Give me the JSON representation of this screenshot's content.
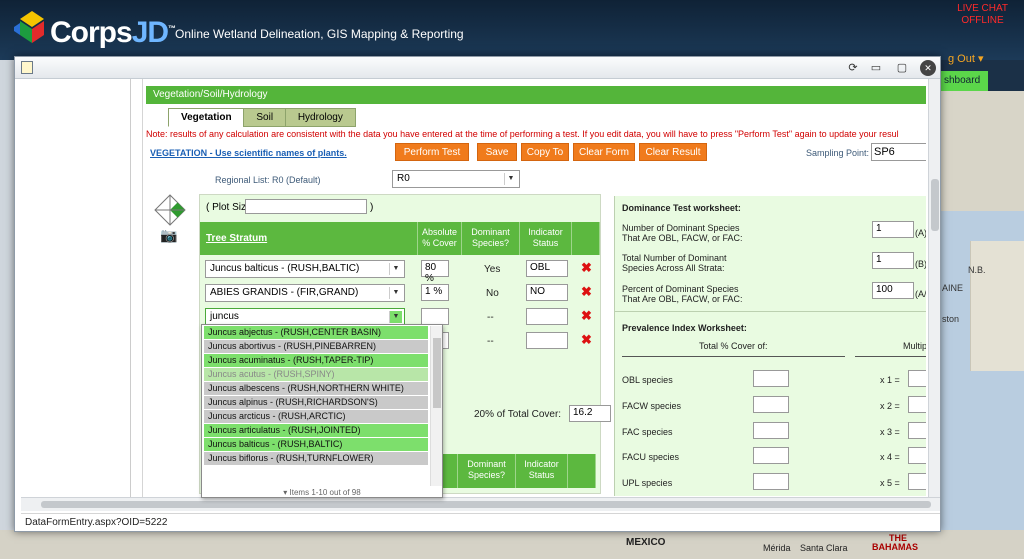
{
  "site": {
    "brand_main": "Corps",
    "brand_accent": "JD",
    "brand_tm": "™",
    "tagline": "Online Wetland Delineation, GIS Mapping & Reporting",
    "live_chat_line1": "LIVE CHAT",
    "live_chat_line2": "OFFLINE",
    "out_link": "g Out ▾",
    "dashboard_tab": "shboard"
  },
  "map": {
    "labels": [
      "N.B.",
      "AINE",
      "ston",
      "MEXICO",
      "Mérida",
      "Santa Clara",
      "THE",
      "BAHAMAS"
    ]
  },
  "window": {
    "controls": [
      "⟳",
      "▭",
      "▢",
      "✕"
    ],
    "status_url": "DataFormEntry.aspx?OID=5222"
  },
  "form": {
    "section_title": "Vegetation/Soil/Hydrology",
    "tabs": [
      "Vegetation",
      "Soil",
      "Hydrology"
    ],
    "active_tab": "Vegetation",
    "note": "Note: results of any calculation are consistent with the data you have entered at the time of performing a test. If you edit data, you will have to press \"Perform Test\" again to update your resul",
    "veg_link": "VEGETATION - Use scientific names of plants.",
    "buttons": {
      "perform_test": "Perform Test",
      "save": "Save",
      "copy_to": "Copy To",
      "clear_form": "Clear Form",
      "clear_result": "Clear Result"
    },
    "sampling_point_label": "Sampling Point:",
    "sampling_point_value": "SP6",
    "regional_list_label": "Regional List:  R0 (Default)",
    "regional_list_value": "R0",
    "plot_size_label": "( Plot Size:",
    "plot_size_close": ")",
    "table_headers": {
      "tree_stratum": "Tree Stratum",
      "absolute_cover": "Absolute % Cover",
      "dominant": "Dominant Species?",
      "indicator": "Indicator Status"
    },
    "rows": [
      {
        "species": "Juncus balticus -    (RUSH,BALTIC)",
        "cover": "80 %",
        "dominant": "Yes",
        "indicator": "OBL"
      },
      {
        "species": "ABIES GRANDIS -    (FIR,GRAND)",
        "cover": "1 %",
        "dominant": "No",
        "indicator": "NO"
      },
      {
        "species": "juncus",
        "cover": "",
        "dominant": "--",
        "indicator": ""
      },
      {
        "species": "",
        "cover": "",
        "dominant": "--",
        "indicator": ""
      }
    ],
    "twenty_pct_label": "20% of Total Cover:",
    "twenty_pct_value": "16.2",
    "table2_headers": {
      "cover_partial": "te\ner",
      "dominant": "Dominant Species?",
      "indicator": "Indicator Status"
    },
    "table2_dominant": "--",
    "autocomplete": {
      "items": [
        "Juncus abjectus - (RUSH,CENTER BASIN)",
        "Juncus abortivus - (RUSH,PINEBARREN)",
        "Juncus acuminatus - (RUSH,TAPER-TIP)",
        "Juncus acutus - (RUSH,SPINY)",
        "Juncus albescens - (RUSH,NORTHERN WHITE)",
        "Juncus alpinus - (RUSH,RICHARDSON'S)",
        "Juncus arcticus - (RUSH,ARCTIC)",
        "Juncus articulatus - (RUSH,JOINTED)",
        "Juncus balticus - (RUSH,BALTIC)",
        "Juncus biflorus - (RUSH,TURNFLOWER)"
      ],
      "item_styles": [
        "green",
        "gray",
        "green",
        "hl",
        "gray",
        "gray",
        "gray",
        "green",
        "green",
        "gray"
      ],
      "footer": "▾ Items 1-10 out of 98"
    }
  },
  "dominance": {
    "title": "Dominance Test worksheet:",
    "q1_line1": "Number of Dominant Species",
    "q1_line2": "That Are OBL, FACW, or FAC:",
    "q1_value": "1",
    "q1_tag": "(A)",
    "q2_line1": "Total Number of Dominant",
    "q2_line2": "Species Across All Strata:",
    "q2_value": "1",
    "q2_tag": "(B)",
    "q3_line1": "Percent of Dominant Species",
    "q3_line2": "That Are OBL, FACW, or FAC:",
    "q3_value": "100",
    "q3_tag": "(A/B)"
  },
  "prevalence": {
    "title": "Prevalence Index Worksheet:",
    "col_total": "Total % Cover of:",
    "col_multiply": "Multiply b",
    "rows": [
      {
        "label": "OBL species",
        "mult": "x 1 ="
      },
      {
        "label": "FACW species",
        "mult": "x 2 ="
      },
      {
        "label": "FAC species",
        "mult": "x 3 ="
      },
      {
        "label": "FACU species",
        "mult": "x 4 ="
      },
      {
        "label": "UPL species",
        "mult": "x 5 ="
      }
    ]
  }
}
